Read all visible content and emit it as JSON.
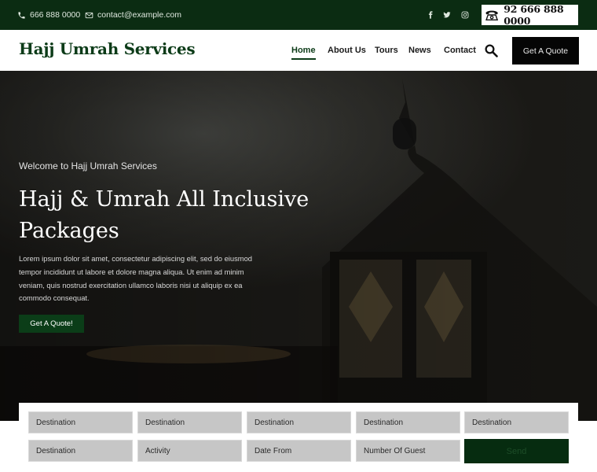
{
  "topbar": {
    "phone": "666 888 0000",
    "email": "contact@example.com",
    "hotline": "92 666 888 0000"
  },
  "header": {
    "logo": "Hajj Umrah Services",
    "nav": [
      "Home",
      "About Us",
      "Tours",
      "News",
      "Contact"
    ],
    "quote_button": "Get A Quote"
  },
  "hero": {
    "welcome": "Welcome to Hajj Umrah Services",
    "title": "Hajj & Umrah All Inclusive Packages",
    "text": "Lorem ipsum dolor sit amet, consectetur adipiscing elit, sed do eiusmod tempor incididunt ut labore et dolore magna aliqua. Ut enim ad minim veniam, quis nostrud exercitation ullamco laboris nisi ut aliquip ex ea commodo consequat.",
    "button": "Get A Quote!"
  },
  "search_form": {
    "row1": [
      "Destination",
      "Destination",
      "Destination",
      "Destination",
      "Destination"
    ],
    "row2": [
      "Destination",
      "Activity",
      "Date From",
      "Number Of Guest"
    ],
    "send": "Send"
  },
  "colors": {
    "brand_dark_green": "#0b2c12",
    "accent_green": "#0c3b18",
    "button_black": "#050505"
  }
}
